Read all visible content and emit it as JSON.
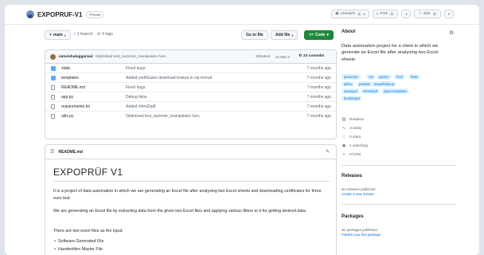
{
  "repo": {
    "name": "EXPOPRUF-V1",
    "visibility": "Private"
  },
  "header_buttons": {
    "unwatch": {
      "label": "Unwatch",
      "count": "1"
    },
    "fork": {
      "label": "Fork",
      "count": "0"
    },
    "star": {
      "label": "Star",
      "count": "0"
    }
  },
  "toolbar": {
    "branch": "main",
    "branches": "1 branch",
    "tags": "0 tags",
    "go_to_file": "Go to file",
    "add_file": "Add file",
    "code": "Code"
  },
  "commit": {
    "author": "iamvishalaggarwal",
    "message": "Optimised test_nummer_manipulator func",
    "hash": "285a6e1",
    "date": "on Mar 3",
    "commits": "23 commits"
  },
  "files": [
    {
      "type": "dir",
      "name": "static",
      "message": "Fixed bugs",
      "date": "7 months ago"
    },
    {
      "type": "dir",
      "name": "templates",
      "message": "Added certificates download feature in zip format",
      "date": "7 months ago"
    },
    {
      "type": "file",
      "name": "README.md",
      "message": "Fixed bugs",
      "date": "7 months ago"
    },
    {
      "type": "file",
      "name": "app.py",
      "message": "Debug false",
      "date": "7 months ago"
    },
    {
      "type": "file",
      "name": "requirements.txt",
      "message": "Added xhtml2pdf",
      "date": "7 months ago"
    },
    {
      "type": "file",
      "name": "utils.py",
      "message": "Optimised test_nummer_manipulator func",
      "date": "7 months ago"
    }
  ],
  "readme": {
    "file": "README.md",
    "heading": "EXPOPRÜF V1",
    "p1": "It is a project of data automation in which we are generating an Excel file after analysing two Excel sheets and downloading certificates for three euro test.",
    "p2": "We are generating an Excel file by extracting data from the given two Excel files and applying various filters to it for getting desired data.",
    "p3": "There are two excel files as the input:",
    "items": [
      "Software Generated File",
      "Handwritten Master File"
    ]
  },
  "sidebar": {
    "about_title": "About",
    "description": "Data automation project for a client in which we generate an Excel file after analysing two Excel sheets",
    "topics": [
      "javascript",
      "css",
      "python",
      "html",
      "flask",
      "pillow",
      "pandas",
      "beautifulsoup",
      "openpyxl",
      "xhtml2pdf",
      "jinja2-templates",
      "bootstrap5"
    ],
    "readme": "Readme",
    "activity": "Activity",
    "stars": "0 stars",
    "watching": "1 watching",
    "forks": "0 forks",
    "releases_title": "Releases",
    "releases_none": "No releases published",
    "releases_link": "Create a new release",
    "packages_title": "Packages",
    "packages_none": "No packages published",
    "packages_link": "Publish your first package"
  },
  "colors": {
    "accent": "#0969da",
    "code_button": "#1f883d",
    "folder": "#54aeff",
    "topic_bg": "#ddf4ff"
  }
}
